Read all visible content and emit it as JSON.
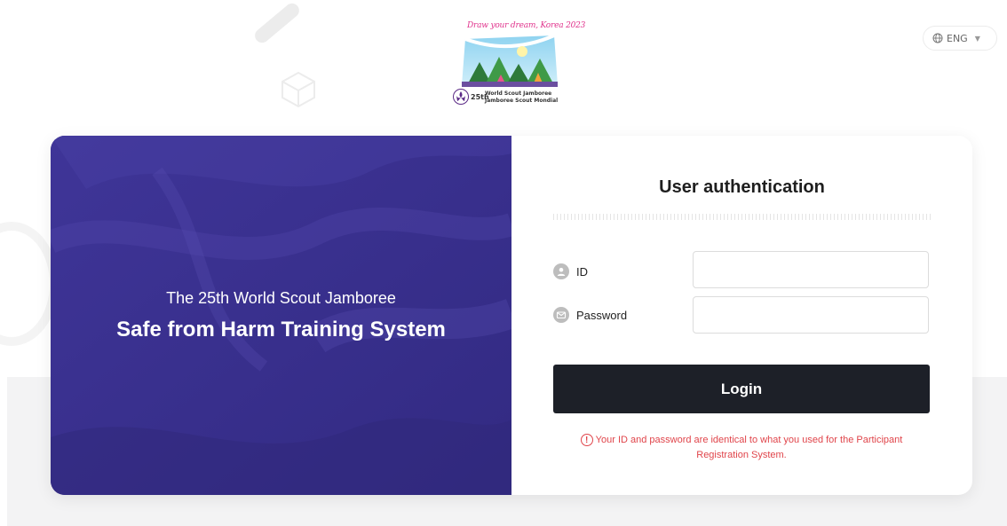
{
  "logo": {
    "tagline": "Draw your dream, Korea 2023",
    "edition": "25th",
    "line1": "World Scout Jamboree",
    "line2": "Jamboree Scout Mondial"
  },
  "language": {
    "selected": "ENG",
    "icon": "globe-icon"
  },
  "hero": {
    "subtitle": "The 25th World Scout Jamboree",
    "title": "Safe from Harm Training System"
  },
  "auth": {
    "title": "User authentication",
    "id_label": "ID",
    "password_label": "Password",
    "id_value": "",
    "password_value": "",
    "login_label": "Login",
    "notice": "Your ID and password are identical to what you used for the Participant Registration System.",
    "notice_icon": "!"
  },
  "colors": {
    "hero_bg": "#3a318e",
    "button_bg": "#1d2028",
    "notice": "#e0444a"
  }
}
